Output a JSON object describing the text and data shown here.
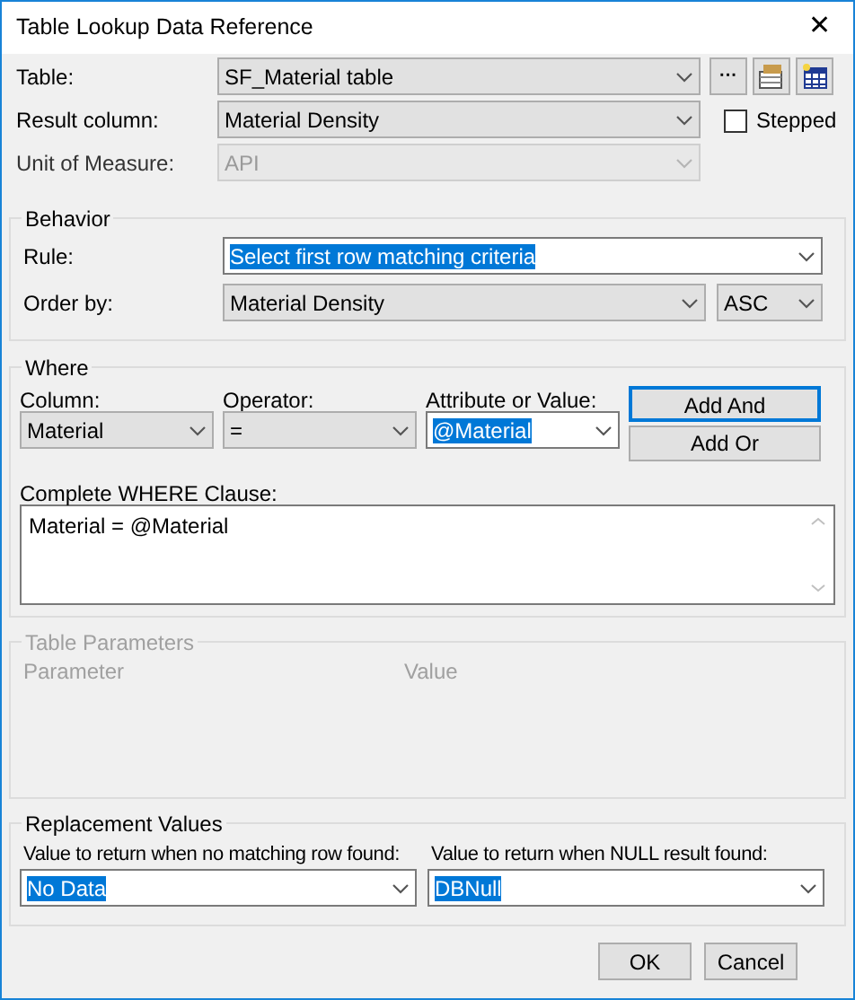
{
  "window": {
    "title": "Table Lookup Data Reference",
    "close": "✕"
  },
  "top": {
    "rows": [
      {
        "label": "Table:",
        "combo": {
          "value": "SF_Material table",
          "editable": false,
          "disabled": false,
          "highlighted": false
        }
      },
      {
        "label": "Result column:",
        "combo": {
          "value": "Material Density",
          "editable": false,
          "disabled": false,
          "highlighted": false
        }
      },
      {
        "label": "Unit of Measure:",
        "combo": {
          "value": "API",
          "editable": false,
          "disabled": true,
          "highlighted": false
        }
      }
    ],
    "ellipsis_button": "···",
    "stepped": {
      "label": "Stepped",
      "checked": false
    }
  },
  "behavior": {
    "title": "Behavior",
    "rule": {
      "label": "Rule:",
      "combo": {
        "value": "Select first row matching criteria",
        "editable": true,
        "disabled": false,
        "highlighted": true
      }
    },
    "order_by": {
      "label": "Order by:",
      "combo": {
        "value": "Material Density",
        "editable": false,
        "disabled": false,
        "highlighted": false
      },
      "direction": {
        "value": "ASC",
        "editable": false,
        "disabled": false,
        "highlighted": false
      }
    }
  },
  "where": {
    "title": "Where",
    "fields": [
      {
        "label": "Column:",
        "combo": {
          "value": "Material",
          "editable": false,
          "disabled": false,
          "highlighted": false
        }
      },
      {
        "label": "Operator:",
        "combo": {
          "value": "=",
          "editable": false,
          "disabled": false,
          "highlighted": false
        }
      },
      {
        "label": "Attribute or Value:",
        "combo": {
          "value": "@Material",
          "editable": true,
          "disabled": false,
          "highlighted": true
        }
      }
    ],
    "buttons": [
      {
        "label": "Add And",
        "default": true
      },
      {
        "label": "Add Or",
        "default": false
      }
    ],
    "clause_label": "Complete WHERE Clause:",
    "clause": "Material = @Material"
  },
  "table_parameters": {
    "title": "Table Parameters",
    "disabled": true,
    "columns": [
      "Parameter",
      "Value"
    ]
  },
  "replacement": {
    "title": "Replacement Values",
    "fields": [
      {
        "label": "Value to return when no matching row found:",
        "combo": {
          "value": "No Data",
          "editable": true,
          "disabled": false,
          "highlighted": true
        }
      },
      {
        "label": "Value to return when NULL result found:",
        "combo": {
          "value": "DBNull",
          "editable": true,
          "disabled": false,
          "highlighted": true
        }
      }
    ]
  },
  "buttons": [
    "OK",
    "Cancel"
  ]
}
